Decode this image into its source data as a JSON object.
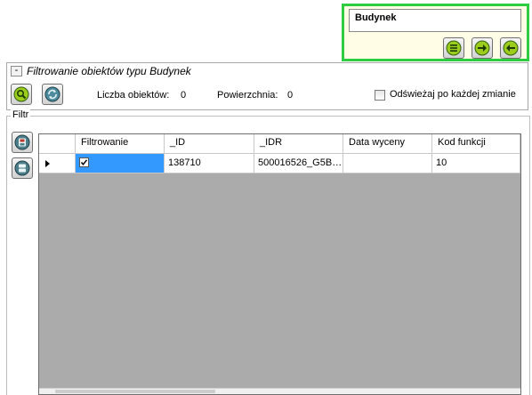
{
  "object_panel": {
    "name": "Budynek",
    "buttons": [
      {
        "icon": "list-icon"
      },
      {
        "icon": "arrow-right-icon"
      },
      {
        "icon": "arrow-left-icon"
      }
    ]
  },
  "filter": {
    "collapse_symbol": "-",
    "title": "Filtrowanie obiektów typu Budynek",
    "count_label": "Liczba obiektów:",
    "count_value": "0",
    "area_label": "Powierzchnia:",
    "area_value": "0",
    "refresh_label": "Odświeżaj po każdej zmianie",
    "refresh_checked": false
  },
  "filtr_group": {
    "label": "Filtr"
  },
  "grid": {
    "columns": [
      "Filtrowanie",
      "_ID",
      "_IDR",
      "Data wyceny",
      "Kod funkcji"
    ],
    "rows": [
      {
        "filtrowanie": true,
        "id": "138710",
        "idr": "500016526_G5B…",
        "data_wyceny": "",
        "kod_funkcji": "10"
      }
    ]
  },
  "colors": {
    "panel_border": "#2ecc40",
    "panel_bg": "#fffde6",
    "grid_empty": "#ababab",
    "selected_cell": "#3399ff"
  }
}
